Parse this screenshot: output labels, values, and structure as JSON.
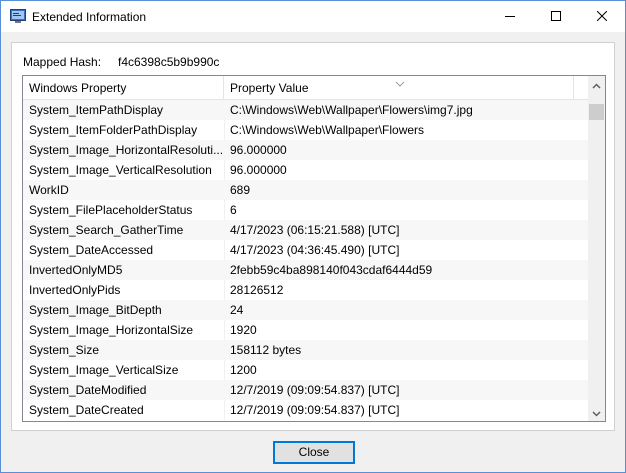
{
  "window": {
    "title": "Extended Information",
    "app_icon": "properties-window-icon",
    "controls": {
      "minimize": "minimize-icon",
      "maximize": "maximize-icon",
      "close": "close-icon"
    }
  },
  "hash": {
    "label": "Mapped Hash:",
    "value": "f4c6398c5b9b990c"
  },
  "table": {
    "columns": [
      "Windows Property",
      "Property Value"
    ],
    "rows": [
      [
        "System_ItemPathDisplay",
        "C:\\Windows\\Web\\Wallpaper\\Flowers\\img7.jpg"
      ],
      [
        "System_ItemFolderPathDisplay",
        "C:\\Windows\\Web\\Wallpaper\\Flowers"
      ],
      [
        "System_Image_HorizontalResoluti...",
        "96.000000"
      ],
      [
        "System_Image_VerticalResolution",
        "96.000000"
      ],
      [
        "WorkID",
        "689"
      ],
      [
        "System_FilePlaceholderStatus",
        "6"
      ],
      [
        "System_Search_GatherTime",
        "4/17/2023 (06:15:21.588) [UTC]"
      ],
      [
        "System_DateAccessed",
        "4/17/2023 (04:36:45.490) [UTC]"
      ],
      [
        "InvertedOnlyMD5",
        "2febb59c4ba898140f043cdaf6444d59"
      ],
      [
        "InvertedOnlyPids",
        "28126512"
      ],
      [
        "System_Image_BitDepth",
        "24"
      ],
      [
        "System_Image_HorizontalSize",
        "1920"
      ],
      [
        "System_Size",
        "158112 bytes"
      ],
      [
        "System_Image_VerticalSize",
        "1200"
      ],
      [
        "System_DateModified",
        "12/7/2019 (09:09:54.837) [UTC]"
      ],
      [
        "System_DateCreated",
        "12/7/2019 (09:09:54.837) [UTC]"
      ]
    ]
  },
  "buttons": {
    "close": "Close"
  }
}
